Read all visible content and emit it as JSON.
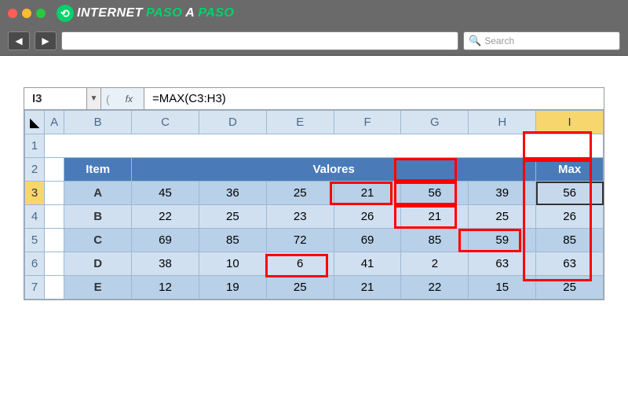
{
  "browser": {
    "brand_white": "INTERNET",
    "brand_green1": "PASO",
    "brand_white2": "A",
    "brand_green2": "PASO",
    "search_placeholder": "Search"
  },
  "excel": {
    "name_box": "I3",
    "fx_label": "fx",
    "formula": "=MAX(C3:H3)",
    "columns": [
      "A",
      "B",
      "C",
      "D",
      "E",
      "F",
      "G",
      "H",
      "I"
    ],
    "rows": [
      "1",
      "2",
      "3",
      "4",
      "5",
      "6",
      "7"
    ],
    "header": {
      "item": "Item",
      "valores": "Valores",
      "max": "Max"
    },
    "data": [
      {
        "item": "A",
        "v": [
          "45",
          "36",
          "25",
          "21",
          "56",
          "39"
        ],
        "max": "56"
      },
      {
        "item": "B",
        "v": [
          "22",
          "25",
          "23",
          "26",
          "21",
          "25"
        ],
        "max": "26"
      },
      {
        "item": "C",
        "v": [
          "69",
          "85",
          "72",
          "69",
          "85",
          "59"
        ],
        "max": "85"
      },
      {
        "item": "D",
        "v": [
          "38",
          "10",
          "6",
          "41",
          "2",
          "63"
        ],
        "max": "63"
      },
      {
        "item": "E",
        "v": [
          "12",
          "19",
          "25",
          "21",
          "22",
          "15"
        ],
        "max": "25"
      }
    ]
  }
}
